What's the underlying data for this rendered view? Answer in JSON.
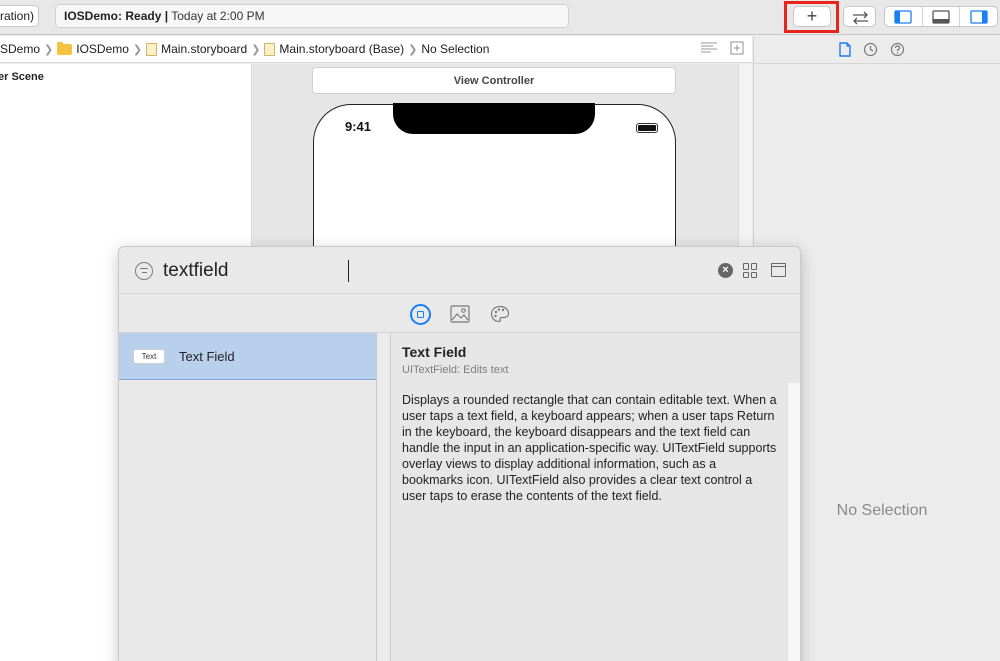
{
  "toolbar": {
    "scheme_label": "ration)",
    "activity_project": "IOSDemo:",
    "activity_status": "Ready",
    "activity_separator": "|",
    "activity_time": "Today at 2:00 PM",
    "library_button_label": "+",
    "highlight_color": "#e8251c"
  },
  "jumpbar": {
    "crumbs": [
      "SDemo",
      "IOSDemo",
      "Main.storyboard",
      "Main.storyboard (Base)",
      "No Selection"
    ]
  },
  "outline": {
    "scene_label": "er Scene"
  },
  "canvas": {
    "view_controller_title": "View Controller",
    "status_time": "9:41"
  },
  "inspector": {
    "empty_label": "No Selection"
  },
  "library": {
    "search_value": "textfield",
    "items": [
      {
        "badge": "Text",
        "label": "Text Field"
      }
    ],
    "detail": {
      "title": "Text Field",
      "subtitle": "UITextField: Edits text",
      "description": "Displays a rounded rectangle that can contain editable text. When a user taps a text field, a keyboard appears; when a user taps Return in the keyboard, the keyboard disappears and the text field can handle the input in an application-specific way. UITextField supports overlay views to display additional information, such as a bookmarks icon. UITextField also provides a clear text control a user taps to erase the contents of the text field."
    },
    "selection_color": "#b9d0ec",
    "accent_color": "#1a7ef5"
  }
}
